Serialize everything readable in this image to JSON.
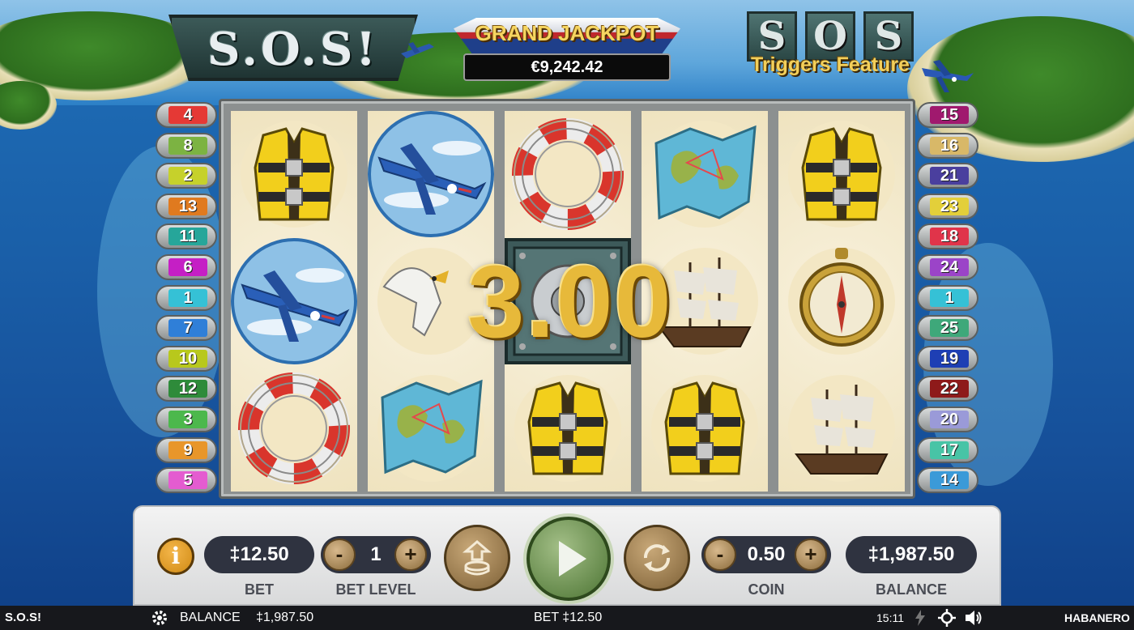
{
  "header": {
    "logo_text": "S.O.S!",
    "jackpot_title": "GRAND JACKPOT",
    "jackpot_amount": "€9,242.42",
    "feature_letters": [
      "S",
      "O",
      "S"
    ],
    "feature_text": "Triggers Feature"
  },
  "paylines": {
    "left": [
      {
        "n": "4",
        "color": "#e53935"
      },
      {
        "n": "8",
        "color": "#7cb342"
      },
      {
        "n": "2",
        "color": "#c6d12b"
      },
      {
        "n": "13",
        "color": "#e07a1f"
      },
      {
        "n": "11",
        "color": "#26a69a"
      },
      {
        "n": "6",
        "color": "#c51fc5"
      },
      {
        "n": "1",
        "color": "#35c1d6"
      },
      {
        "n": "7",
        "color": "#2f7fd8"
      },
      {
        "n": "10",
        "color": "#b8c81c"
      },
      {
        "n": "12",
        "color": "#2e8b3a"
      },
      {
        "n": "3",
        "color": "#4cb84c"
      },
      {
        "n": "9",
        "color": "#e8962a"
      },
      {
        "n": "5",
        "color": "#e45cd0"
      }
    ],
    "right": [
      {
        "n": "15",
        "color": "#a0196e"
      },
      {
        "n": "16",
        "color": "#d8b868"
      },
      {
        "n": "21",
        "color": "#4a3f9e"
      },
      {
        "n": "23",
        "color": "#e3cf3a"
      },
      {
        "n": "18",
        "color": "#e0344a"
      },
      {
        "n": "24",
        "color": "#9b44c8"
      },
      {
        "n": "1",
        "color": "#35c1d6"
      },
      {
        "n": "25",
        "color": "#3ea87a"
      },
      {
        "n": "19",
        "color": "#1e3fb4"
      },
      {
        "n": "22",
        "color": "#8e1a1a"
      },
      {
        "n": "20",
        "color": "#9a9ad8"
      },
      {
        "n": "17",
        "color": "#48c4a6"
      },
      {
        "n": "14",
        "color": "#3b9ad8"
      }
    ]
  },
  "reels": [
    [
      "life-vest-symbol",
      "plane-symbol",
      "life-ring-symbol"
    ],
    [
      "plane-symbol",
      "seagull-symbol",
      "map-symbol"
    ],
    [
      "life-ring-symbol",
      "safe-symbol",
      "life-vest-symbol"
    ],
    [
      "map-symbol",
      "ship-symbol",
      "life-vest-symbol"
    ],
    [
      "life-vest-symbol",
      "compass-symbol",
      "ship-symbol"
    ]
  ],
  "win_amount": "3.00",
  "controls": {
    "bet_value": "‡12.50",
    "bet_label": "BET",
    "bet_level_value": "1",
    "bet_level_label": "BET LEVEL",
    "coin_value": "0.50",
    "coin_label": "COIN",
    "balance_value": "‡1,987.50",
    "balance_label": "BALANCE",
    "minus": "-",
    "plus": "+",
    "info": "i"
  },
  "statusbar": {
    "game_name": "S.O.S!",
    "balance_label": "BALANCE",
    "balance_value": "‡1,987.50",
    "bet_text": "BET ‡12.50",
    "time": "15:11",
    "provider": "HABANERO"
  }
}
